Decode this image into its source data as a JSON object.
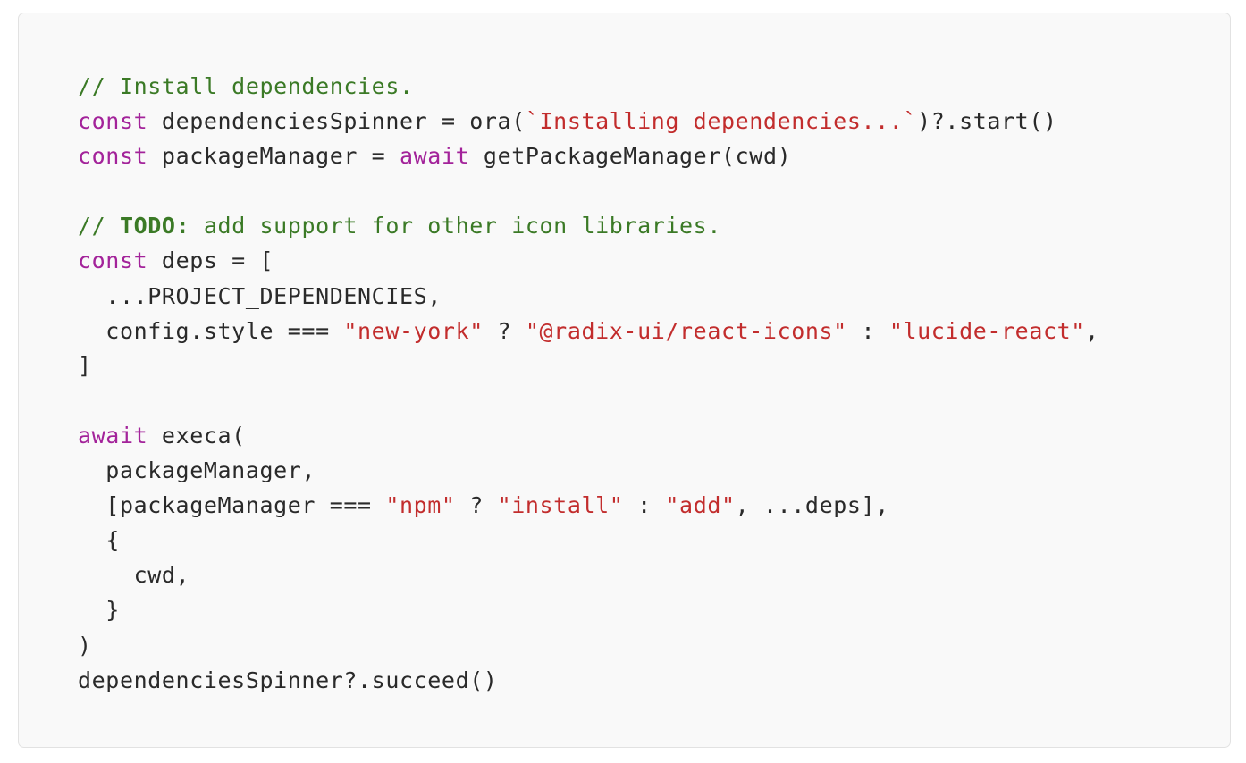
{
  "language": "javascript",
  "colors": {
    "background": "#f9f9f9",
    "border": "#e2e2e2",
    "comment": "#3b7a26",
    "keyword": "#a3239a",
    "string": "#c22d2d",
    "plain": "#2a2a2a"
  },
  "lines": [
    [
      {
        "t": "comment",
        "v": "// Install dependencies."
      }
    ],
    [
      {
        "t": "keyword",
        "v": "const"
      },
      {
        "t": "plain",
        "v": " dependenciesSpinner = ora("
      },
      {
        "t": "string",
        "v": "`Installing dependencies...`"
      },
      {
        "t": "plain",
        "v": ")?.start()"
      }
    ],
    [
      {
        "t": "keyword",
        "v": "const"
      },
      {
        "t": "plain",
        "v": " packageManager = "
      },
      {
        "t": "keyword",
        "v": "await"
      },
      {
        "t": "plain",
        "v": " getPackageManager(cwd)"
      }
    ],
    [],
    [
      {
        "t": "comment",
        "v": "// "
      },
      {
        "t": "comment-bold",
        "v": "TODO:"
      },
      {
        "t": "comment",
        "v": " add support for other icon libraries."
      }
    ],
    [
      {
        "t": "keyword",
        "v": "const"
      },
      {
        "t": "plain",
        "v": " deps = ["
      }
    ],
    [
      {
        "t": "plain",
        "v": "  ...PROJECT_DEPENDENCIES,"
      }
    ],
    [
      {
        "t": "plain",
        "v": "  config.style === "
      },
      {
        "t": "string",
        "v": "\"new-york\""
      },
      {
        "t": "plain",
        "v": " ? "
      },
      {
        "t": "string",
        "v": "\"@radix-ui/react-icons\""
      },
      {
        "t": "plain",
        "v": " : "
      },
      {
        "t": "string",
        "v": "\"lucide-react\""
      },
      {
        "t": "plain",
        "v": ","
      }
    ],
    [
      {
        "t": "plain",
        "v": "]"
      }
    ],
    [],
    [
      {
        "t": "keyword",
        "v": "await"
      },
      {
        "t": "plain",
        "v": " execa("
      }
    ],
    [
      {
        "t": "plain",
        "v": "  packageManager,"
      }
    ],
    [
      {
        "t": "plain",
        "v": "  [packageManager === "
      },
      {
        "t": "string",
        "v": "\"npm\""
      },
      {
        "t": "plain",
        "v": " ? "
      },
      {
        "t": "string",
        "v": "\"install\""
      },
      {
        "t": "plain",
        "v": " : "
      },
      {
        "t": "string",
        "v": "\"add\""
      },
      {
        "t": "plain",
        "v": ", ...deps],"
      }
    ],
    [
      {
        "t": "plain",
        "v": "  {"
      }
    ],
    [
      {
        "t": "plain",
        "v": "    cwd,"
      }
    ],
    [
      {
        "t": "plain",
        "v": "  }"
      }
    ],
    [
      {
        "t": "plain",
        "v": ")"
      }
    ],
    [
      {
        "t": "plain",
        "v": "dependenciesSpinner?.succeed()"
      }
    ]
  ]
}
